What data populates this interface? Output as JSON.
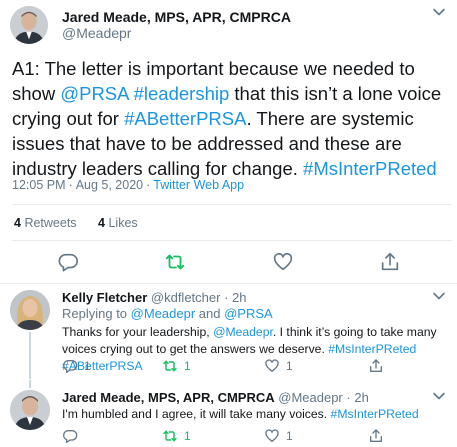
{
  "main_tweet": {
    "author_name": "Jared Meade, MPS, APR, CMPRCA",
    "author_handle": "@Meadepr",
    "text_prefix": "A1: The letter is important because we needed to show ",
    "mention_prsa": "@PRSA",
    "hashtag_leadership": "#leadership",
    "text_mid1": " that this isn’t a lone voice crying out for ",
    "hashtag_abetterprsa": "#ABetterPRSA",
    "text_mid2": ". There are systemic issues that have to be addressed and these are industry leaders calling for change. ",
    "hashtag_msinterpreted": "#MsInterPReted",
    "time": "12:05 PM",
    "separator": "·",
    "date": "Aug 5, 2020",
    "source": "Twitter Web App",
    "retweets_count": "4",
    "retweets_label": "Retweets",
    "likes_count": "4",
    "likes_label": "Likes"
  },
  "replies": [
    {
      "author_name": "Kelly Fletcher",
      "author_handle": "@kdfletcher",
      "separator": "·",
      "age": "2h",
      "replying_label": "Replying to ",
      "replying_to_1": "@Meadepr",
      "replying_and": " and ",
      "replying_to_2": "@PRSA",
      "text_prefix": "Thanks for your leadership, ",
      "mention": "@Meadepr",
      "text_mid": ". I think it’s going to take many voices crying out to get the answers we deserve. ",
      "hashtag_1": "#MsInterPReted",
      "hashtag_2": "#ABetterPRSA",
      "reply_count": "1",
      "retweet_count": "1",
      "like_count": "1"
    },
    {
      "author_name": "Jared Meade, MPS, APR, CMPRCA",
      "author_handle": "@Meadepr",
      "separator": "·",
      "age": "2h",
      "text_prefix": "I'm humbled and I agree, it will take many voices. ",
      "hashtag_1": "#MsInterPReted",
      "retweet_count": "1",
      "like_count": "1"
    }
  ],
  "colors": {
    "link": "#1b95e0",
    "muted": "#657786",
    "retweet_active": "#17bf63",
    "divider": "#e6ecf0"
  },
  "icons": [
    "reply-icon",
    "retweet-icon",
    "like-icon",
    "share-icon",
    "chevron-down-icon"
  ]
}
